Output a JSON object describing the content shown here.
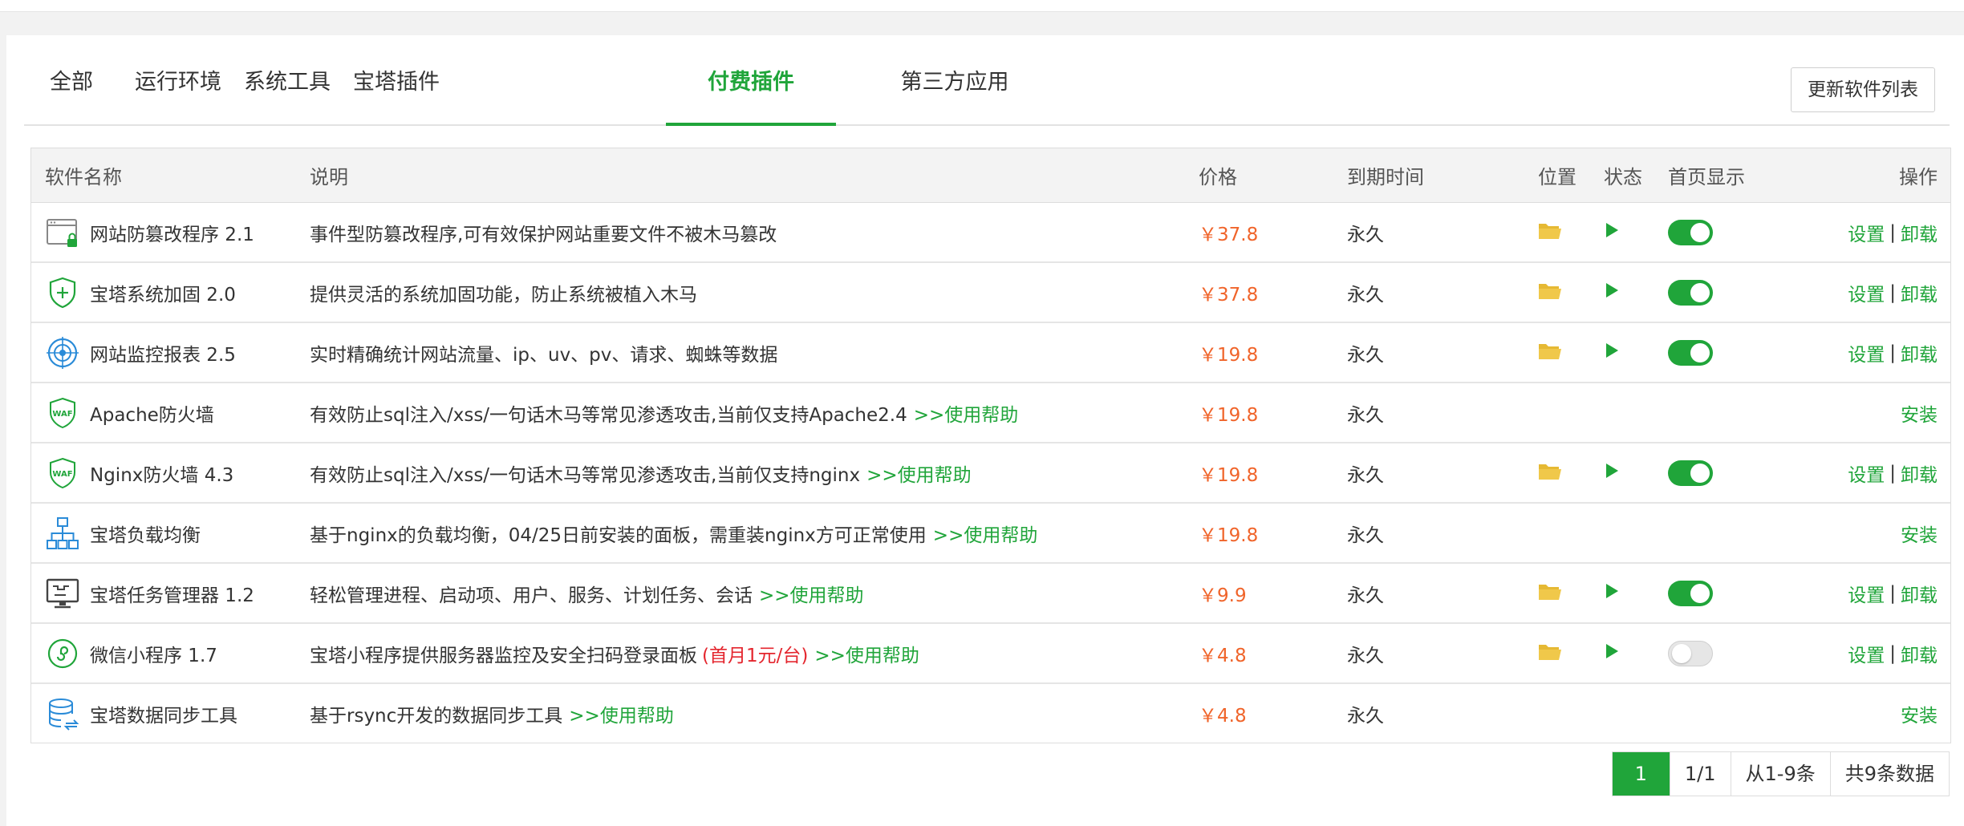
{
  "tabs": [
    {
      "label": "全部"
    },
    {
      "label": "运行环境"
    },
    {
      "label": "系统工具"
    },
    {
      "label": "宝塔插件"
    },
    {
      "label": "付费插件"
    },
    {
      "label": "第三方应用"
    }
  ],
  "active_tab": "付费插件",
  "refresh_button": "更新软件列表",
  "table": {
    "headers": {
      "name": "软件名称",
      "desc": "说明",
      "price": "价格",
      "expire": "到期时间",
      "location": "位置",
      "status": "状态",
      "home": "首页显示",
      "ops": "操作"
    },
    "rows": [
      {
        "name": "网站防篡改程序 2.1",
        "desc": "事件型防篡改程序,可有效保护网站重要文件不被木马篡改",
        "help": "",
        "promo": "",
        "price": "￥37.8",
        "expire": "永久",
        "installed": true,
        "home_display": true,
        "icon": "browser-lock-icon"
      },
      {
        "name": "宝塔系统加固 2.0",
        "desc": "提供灵活的系统加固功能，防止系统被植入木马",
        "help": "",
        "promo": "",
        "price": "￥37.8",
        "expire": "永久",
        "installed": true,
        "home_display": true,
        "icon": "shield-plus-icon"
      },
      {
        "name": "网站监控报表 2.5",
        "desc": "实时精确统计网站流量、ip、uv、pv、请求、蜘蛛等数据",
        "help": "",
        "promo": "",
        "price": "￥19.8",
        "expire": "永久",
        "installed": true,
        "home_display": true,
        "icon": "radar-icon"
      },
      {
        "name": "Apache防火墙",
        "desc": "有效防止sql注入/xss/一句话木马等常见渗透攻击,当前仅支持Apache2.4",
        "help": ">>使用帮助",
        "promo": "",
        "price": "￥19.8",
        "expire": "永久",
        "installed": false,
        "home_display": false,
        "icon": "waf-shield-icon"
      },
      {
        "name": "Nginx防火墙 4.3",
        "desc": "有效防止sql注入/xss/一句话木马等常见渗透攻击,当前仅支持nginx",
        "help": ">>使用帮助",
        "promo": "",
        "price": "￥19.8",
        "expire": "永久",
        "installed": true,
        "home_display": true,
        "icon": "waf-shield-icon"
      },
      {
        "name": "宝塔负载均衡",
        "desc": "基于nginx的负载均衡，04/25日前安装的面板，需重装nginx方可正常使用",
        "help": ">>使用帮助",
        "promo": "",
        "price": "￥19.8",
        "expire": "永久",
        "installed": false,
        "home_display": false,
        "icon": "network-tree-icon"
      },
      {
        "name": "宝塔任务管理器 1.2",
        "desc": "轻松管理进程、启动项、用户、服务、计划任务、会话",
        "help": ">>使用帮助",
        "promo": "",
        "price": "￥9.9",
        "expire": "永久",
        "installed": true,
        "home_display": true,
        "icon": "monitor-icon"
      },
      {
        "name": "微信小程序 1.7",
        "desc": "宝塔小程序提供服务器监控及安全扫码登录面板",
        "help": ">>使用帮助",
        "promo": "(首月1元/台)",
        "price": "￥4.8",
        "expire": "永久",
        "installed": true,
        "home_display": false,
        "icon": "miniprogram-icon"
      },
      {
        "name": "宝塔数据同步工具",
        "desc": "基于rsync开发的数据同步工具",
        "help": ">>使用帮助",
        "promo": "",
        "price": "￥4.8",
        "expire": "永久",
        "installed": false,
        "home_display": false,
        "icon": "database-sync-icon"
      }
    ]
  },
  "ops": {
    "settings": "设置",
    "separator": "|",
    "uninstall": "卸载",
    "install": "安装"
  },
  "pagination": {
    "current": "1",
    "pages": "1/1",
    "range": "从1-9条",
    "total": "共9条数据"
  },
  "colors": {
    "accent": "#20a53a",
    "price": "#f0642a",
    "promo": "#e4262e",
    "folder": "#f0c84a",
    "icon_blue": "#2a8bd8"
  }
}
